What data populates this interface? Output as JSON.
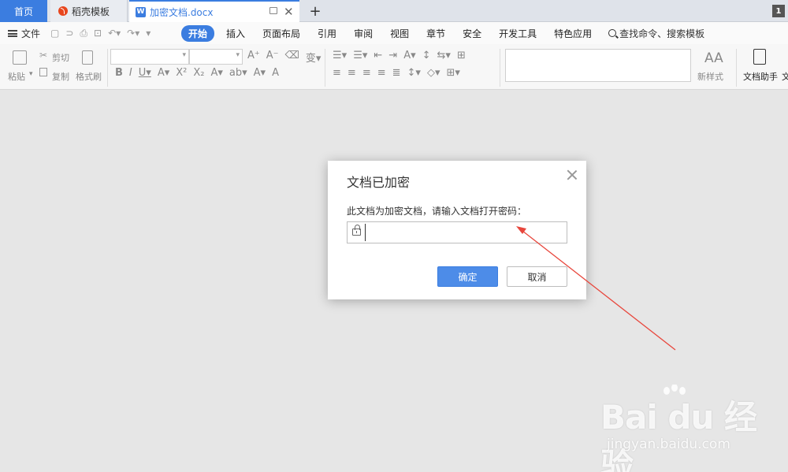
{
  "tabs": {
    "home": "首页",
    "template": "稻壳模板",
    "document": "加密文档.docx",
    "add": "+",
    "document_icon_letter": "W"
  },
  "corner_badge": "1",
  "menu": {
    "file": "文件",
    "items": [
      "开始",
      "插入",
      "页面布局",
      "引用",
      "审阅",
      "视图",
      "章节",
      "安全",
      "开发工具",
      "特色应用"
    ],
    "search": "查找命令、搜索模板"
  },
  "ribbon": {
    "paste": "粘贴",
    "cut": "剪切",
    "copy": "复制",
    "format_painter": "格式刷",
    "new_style": "新样式",
    "doc_helper": "文档助手",
    "doc_helper_partial": "文"
  },
  "dialog": {
    "title": "文档已加密",
    "prompt": "此文档为加密文档，请输入文档打开密码：",
    "password_value": "",
    "ok": "确定",
    "cancel": "取消"
  },
  "colors": {
    "accent": "#3b7de0",
    "annotation_arrow": "#e8463c"
  },
  "watermark": {
    "brand": "Bai du 经验",
    "url": "jingyan.baidu.com"
  }
}
